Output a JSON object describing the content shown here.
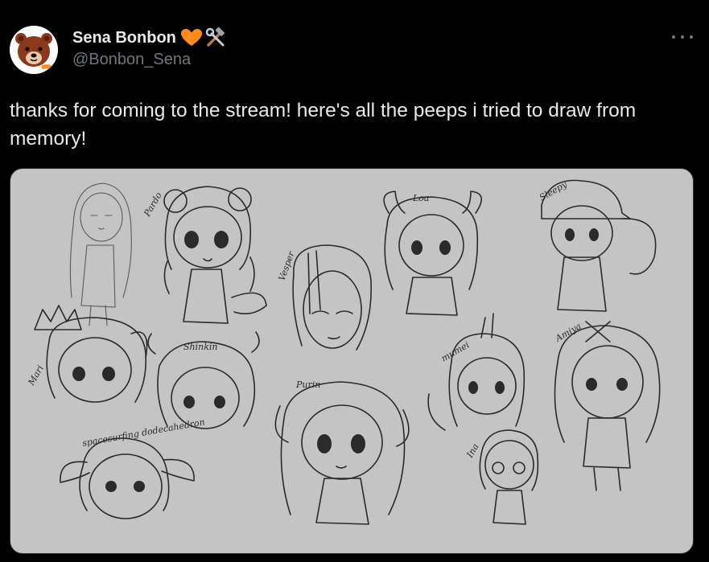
{
  "author": {
    "display_name": "Sena Bonbon",
    "handle": "@Bonbon_Sena",
    "badges": [
      "orange-heart-icon",
      "hammer-wrench-icon"
    ],
    "avatar": "bear-avatar"
  },
  "tweet": {
    "text": "thanks for coming to the stream! here's all the peeps i tried to draw from memory!"
  },
  "media": {
    "type": "sketch-drawing",
    "background": "#c4c4c4",
    "signatures": [
      "Pardo",
      "Sleepy",
      "Loa",
      "Vesper",
      "Mari",
      "Shinkin",
      "Purin",
      "mumei",
      "Amiya",
      "Ina",
      "spacesurfing dodecahedron"
    ]
  },
  "colors": {
    "background": "#000000",
    "text": "#e7e9ea",
    "muted": "#71767b",
    "heart": "#ff8c1a"
  }
}
